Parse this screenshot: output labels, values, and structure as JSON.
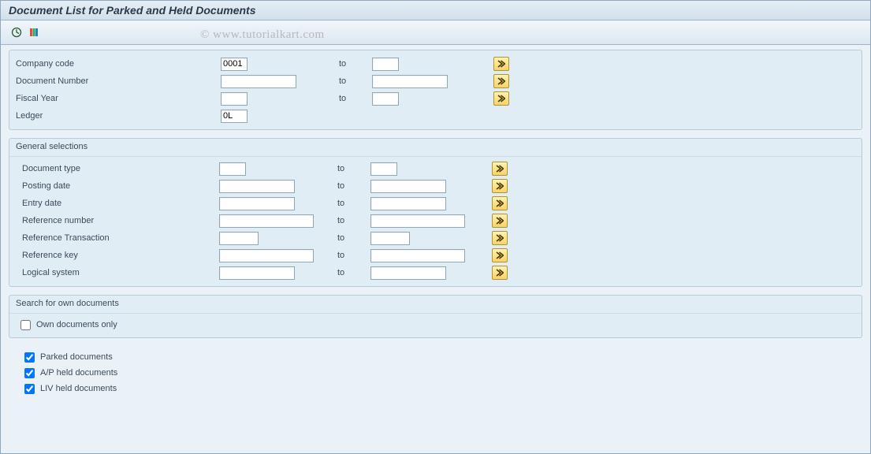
{
  "title": "Document List for Parked and Held Documents",
  "watermark": "© www.tutorialkart.com",
  "toolbar": {
    "execute_icon": "execute-icon",
    "variant_icon": "variant-icon"
  },
  "top_fields": [
    {
      "label": "Company code",
      "from": "0001",
      "to": "",
      "from_w": "w-narrow",
      "to_w": "w-narrow",
      "multi": true
    },
    {
      "label": "Document Number",
      "from": "",
      "to": "",
      "from_w": "w-med",
      "to_w": "w-med",
      "multi": true
    },
    {
      "label": "Fiscal Year",
      "from": "",
      "to": "",
      "from_w": "w-narrow",
      "to_w": "w-narrow",
      "multi": true
    },
    {
      "label": "Ledger",
      "from": "0L",
      "to": null,
      "from_w": "w-narrow",
      "to_w": null,
      "multi": false
    }
  ],
  "to_label": "to",
  "general_title": "General selections",
  "general_fields": [
    {
      "label": "Document type",
      "from": "",
      "to": "",
      "from_w": "w-narrow",
      "to_w": "w-narrow"
    },
    {
      "label": "Posting date",
      "from": "",
      "to": "",
      "from_w": "w-med",
      "to_w": "w-med"
    },
    {
      "label": "Entry date",
      "from": "",
      "to": "",
      "from_w": "w-med",
      "to_w": "w-med"
    },
    {
      "label": "Reference number",
      "from": "",
      "to": "",
      "from_w": "w-wide",
      "to_w": "w-wide"
    },
    {
      "label": "Reference Transaction",
      "from": "",
      "to": "",
      "from_w": "w-small",
      "to_w": "w-small"
    },
    {
      "label": "Reference key",
      "from": "",
      "to": "",
      "from_w": "w-wide",
      "to_w": "w-wide"
    },
    {
      "label": "Logical system",
      "from": "",
      "to": "",
      "from_w": "w-med",
      "to_w": "w-med"
    }
  ],
  "own_title": "Search for own documents",
  "own_check": {
    "label": "Own documents only",
    "checked": false
  },
  "bottom_checks": [
    {
      "label": "Parked documents",
      "checked": true
    },
    {
      "label": "A/P held documents",
      "checked": true
    },
    {
      "label": "LIV held documents",
      "checked": true
    }
  ]
}
